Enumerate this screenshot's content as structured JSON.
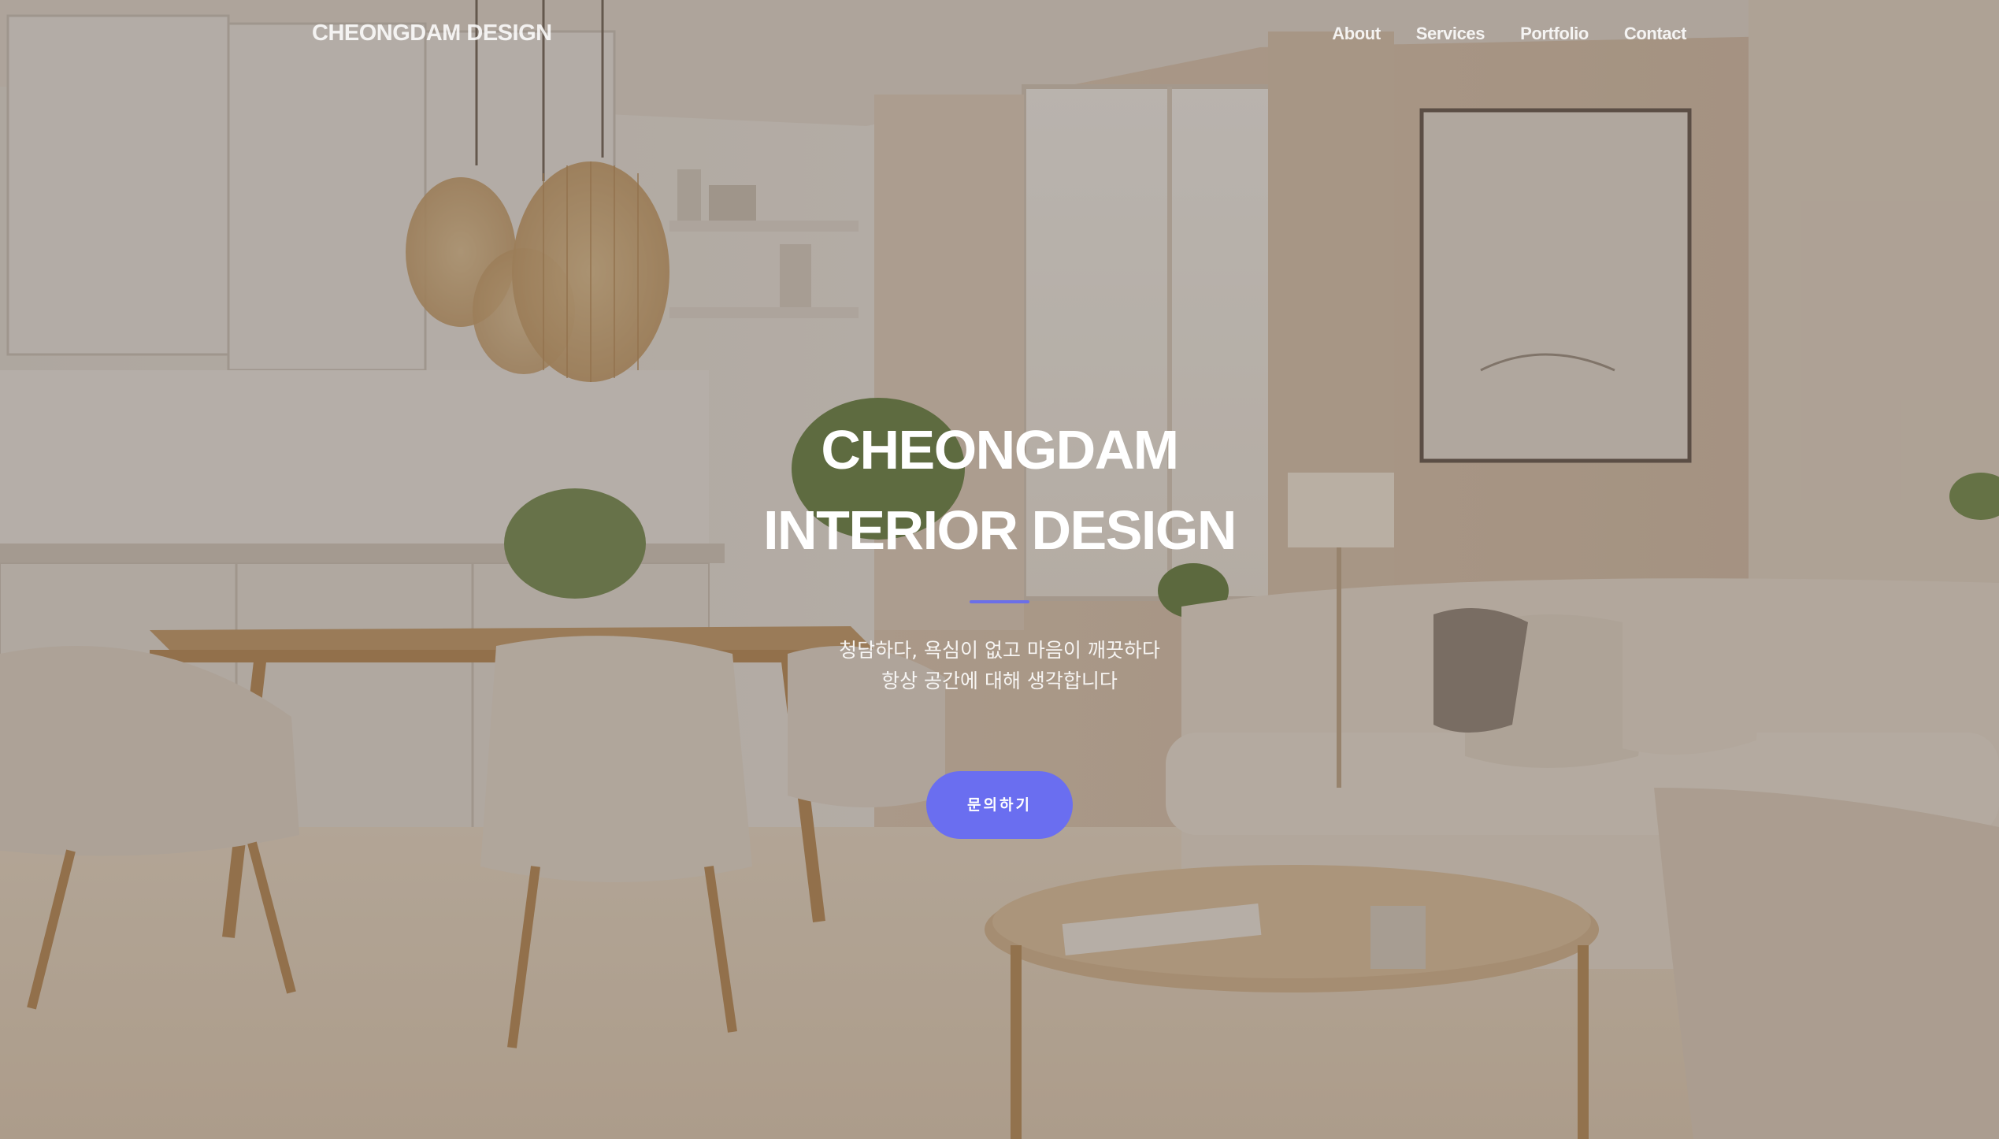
{
  "nav": {
    "brand": "CHEONGDAM DESIGN",
    "links": [
      "About",
      "Services",
      "Portfolio",
      "Contact"
    ]
  },
  "hero": {
    "title_line1": "CHEONGDAM",
    "title_line2": "INTERIOR DESIGN",
    "subtitle_line1": "청담하다, 욕심이 없고 마음이 깨끗하다",
    "subtitle_line2": "항상 공간에 대해 생각합니다",
    "cta_label": "문의하기"
  },
  "colors": {
    "accent": "#6a6ef0",
    "divider": "#6b6fe8",
    "overlay": "#5c5048",
    "text": "#ffffff"
  }
}
